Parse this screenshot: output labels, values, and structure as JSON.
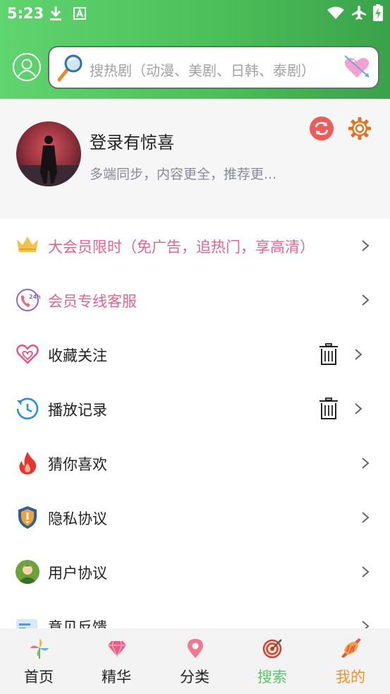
{
  "status_bar": {
    "time": "5:23",
    "icons": [
      "download-icon",
      "a-notification-icon",
      "wifi-icon",
      "airplane-icon",
      "battery-charging-icon"
    ]
  },
  "header": {
    "search_placeholder": "搜热剧（动漫、美剧、日韩、泰剧）",
    "colors": {
      "gradient_start": "#5fd46f",
      "gradient_end": "#3aa24a"
    }
  },
  "profile": {
    "title": "登录有惊喜",
    "subtitle": "多端同步，内容更全，推荐更..."
  },
  "menu": [
    {
      "label": "大会员限时（免广告，追热门，享高清）",
      "icon": "crown-icon",
      "highlight": true,
      "trash": false
    },
    {
      "label": "会员专线客服",
      "icon": "phone-24h-icon",
      "highlight": true,
      "trash": false
    },
    {
      "label": "收藏关注",
      "icon": "heart-icon",
      "highlight": false,
      "trash": true
    },
    {
      "label": "播放记录",
      "icon": "history-icon",
      "highlight": false,
      "trash": true
    },
    {
      "label": "猜你喜欢",
      "icon": "flame-icon",
      "highlight": false,
      "trash": false
    },
    {
      "label": "隐私协议",
      "icon": "shield-icon",
      "highlight": false,
      "trash": false
    },
    {
      "label": "用户协议",
      "icon": "user-icon",
      "highlight": false,
      "trash": false
    },
    {
      "label": "意见反馈",
      "icon": "feedback-icon",
      "highlight": false,
      "trash": false
    }
  ],
  "bottom_nav": {
    "tabs": [
      {
        "label": "首页",
        "icon": "pinwheel-icon"
      },
      {
        "label": "精华",
        "icon": "diamond-icon"
      },
      {
        "label": "分类",
        "icon": "map-pin-icon"
      },
      {
        "label": "搜索",
        "icon": "target-icon"
      },
      {
        "label": "我的",
        "icon": "candy-icon"
      }
    ],
    "colors": {
      "default": "#222222",
      "search": "#5bc46b",
      "mine": "#f0922b"
    }
  }
}
